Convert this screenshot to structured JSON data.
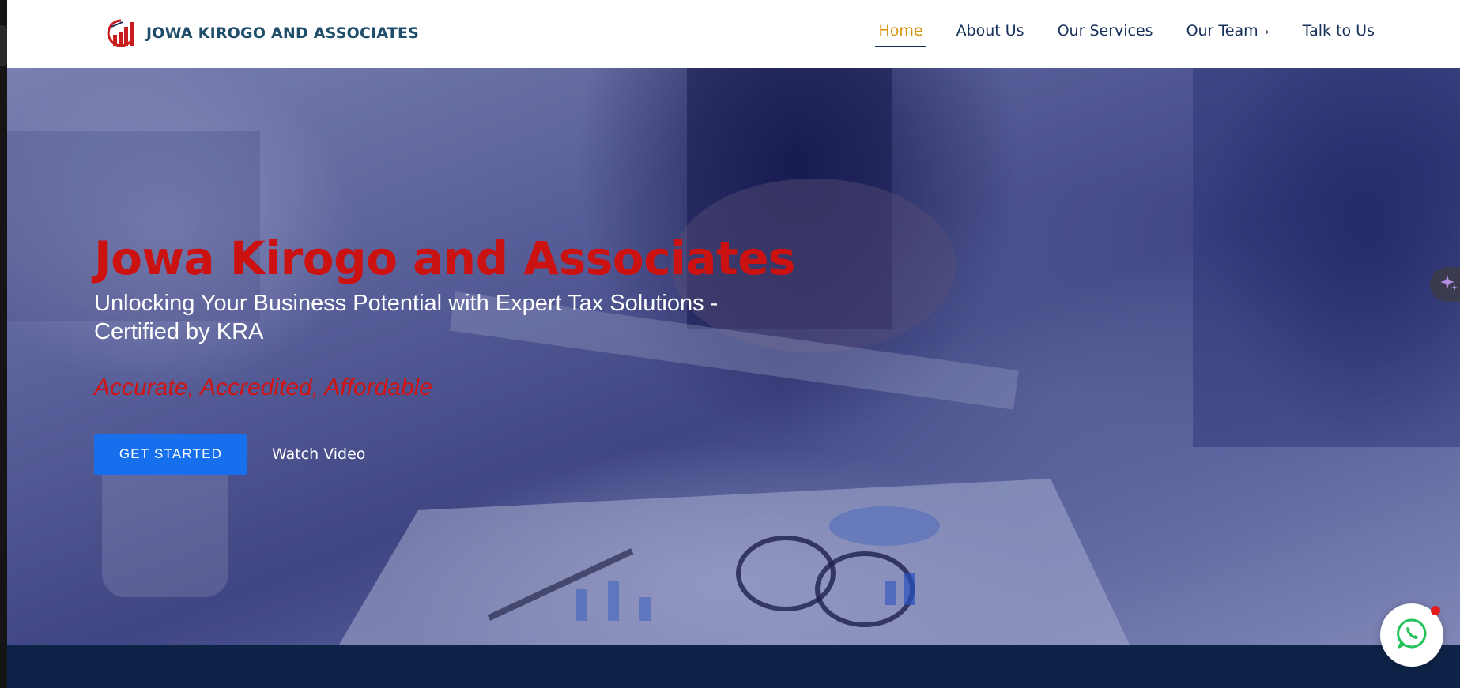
{
  "brand": {
    "name": "JOWA KIROGO AND ASSOCIATES",
    "logo_icon": "bar-chart-logo-icon"
  },
  "nav": {
    "items": [
      {
        "label": "Home",
        "active": true
      },
      {
        "label": "About Us",
        "active": false
      },
      {
        "label": "Our Services",
        "active": false
      },
      {
        "label": "Our Team",
        "active": false,
        "has_submenu": true
      },
      {
        "label": "Talk to Us",
        "active": false
      }
    ]
  },
  "hero": {
    "title": "Jowa Kirogo and Associates",
    "subtitle": "Unlocking Your Business Potential with Expert Tax Solutions - Certified by KRA",
    "tagline": "Accurate, Accredited, Affordable",
    "primary_button": "GET STARTED",
    "secondary_link": "Watch Video"
  },
  "widgets": {
    "side_chip_icon": "sparkle-icon",
    "chat_icon": "whatsapp-icon"
  },
  "colors": {
    "title_red": "#cc1111",
    "nav_active": "#d4930f",
    "nav_text": "#14305a",
    "primary_blue": "#1670ee",
    "footer_band": "#0d2448"
  }
}
